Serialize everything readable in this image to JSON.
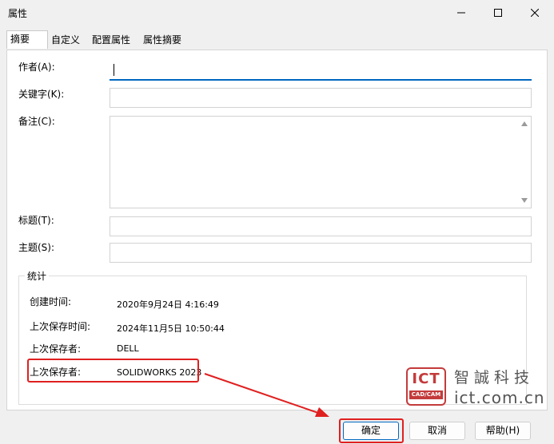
{
  "window": {
    "title": "属性"
  },
  "tabs": [
    {
      "label": "摘要",
      "active": true
    },
    {
      "label": "自定义"
    },
    {
      "label": "配置属性"
    },
    {
      "label": "属性摘要"
    }
  ],
  "fields": {
    "author_label": "作者(A):",
    "author_value": "",
    "keywords_label": "关键字(K):",
    "keywords_value": "",
    "comments_label": "备注(C):",
    "comments_value": "",
    "title_label": "标题(T):",
    "title_value": "",
    "subject_label": "主题(S):",
    "subject_value": ""
  },
  "stats": {
    "group_title": "统计",
    "rows": [
      {
        "label": "创建时间:",
        "value": "2020年9月24日 4:16:49"
      },
      {
        "label": "上次保存时间:",
        "value": "2024年11月5日 10:50:44"
      },
      {
        "label": "上次保存者:",
        "value": "DELL"
      },
      {
        "label": "上次保存者:",
        "value": "SOLIDWORKS 2023"
      }
    ]
  },
  "buttons": {
    "ok": "确定",
    "cancel": "取消",
    "help": "帮助(H)"
  },
  "watermark": {
    "logo_text": "ICT",
    "logo_sub": "CAD/CAM",
    "cn_text": "智誠科技",
    "url": "ict.com.cn"
  },
  "colors": {
    "accent": "#0067c0",
    "highlight": "#e02020",
    "watermark": "#c43b3b"
  }
}
